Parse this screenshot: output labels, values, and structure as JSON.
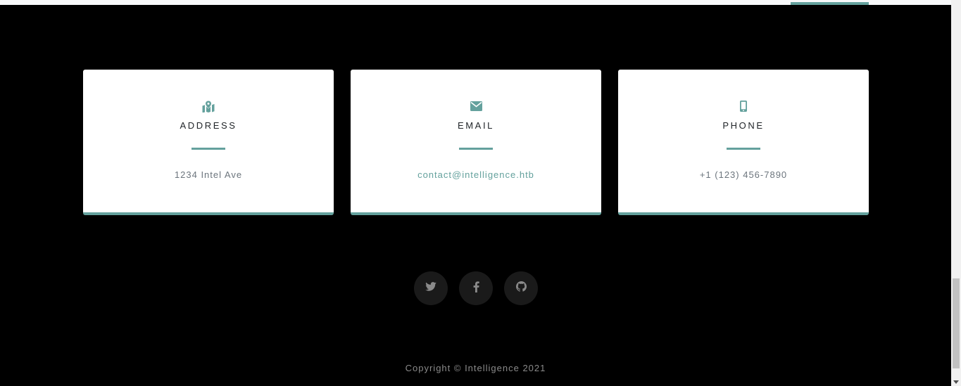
{
  "contact_cards": [
    {
      "icon": "map-marked-icon",
      "title": "Address",
      "value": "1234 Intel Ave"
    },
    {
      "icon": "envelope-icon",
      "title": "Email",
      "value": "contact@intelligence.htb"
    },
    {
      "icon": "mobile-phone-icon",
      "title": "Phone",
      "value": "+1 (123) 456-7890"
    }
  ],
  "social_links": [
    {
      "icon": "twitter-icon"
    },
    {
      "icon": "facebook-icon"
    },
    {
      "icon": "github-icon"
    }
  ],
  "footer": {
    "copyright": "Copyright © Intelligence 2021"
  },
  "colors": {
    "accent": "#64a19d",
    "background": "#000000",
    "card": "#ffffff",
    "text_muted": "#6c757d"
  }
}
